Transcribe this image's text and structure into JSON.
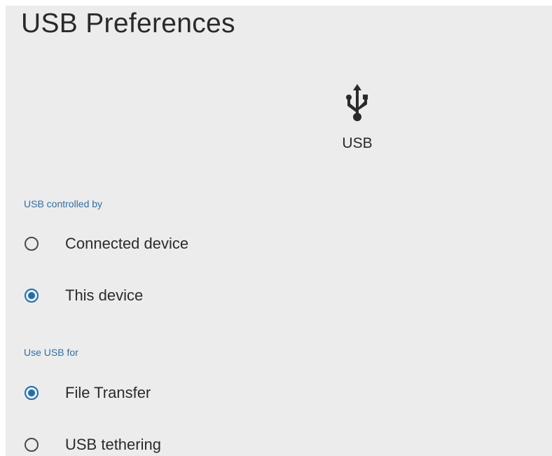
{
  "header": {
    "title": "USB Preferences"
  },
  "usb_icon": {
    "icon": "usb-icon",
    "label": "USB"
  },
  "controlled_by": {
    "section_label": "USB controlled by",
    "options": [
      {
        "label": "Connected device",
        "selected": false
      },
      {
        "label": "This device",
        "selected": true
      }
    ]
  },
  "use_usb_for": {
    "section_label": "Use USB for",
    "options": [
      {
        "label": "File Transfer",
        "selected": true
      },
      {
        "label": "USB tethering",
        "selected": false
      }
    ]
  },
  "colors": {
    "accent": "#1d6fb0",
    "section_header": "#2f6fa6",
    "background": "#ececec"
  }
}
